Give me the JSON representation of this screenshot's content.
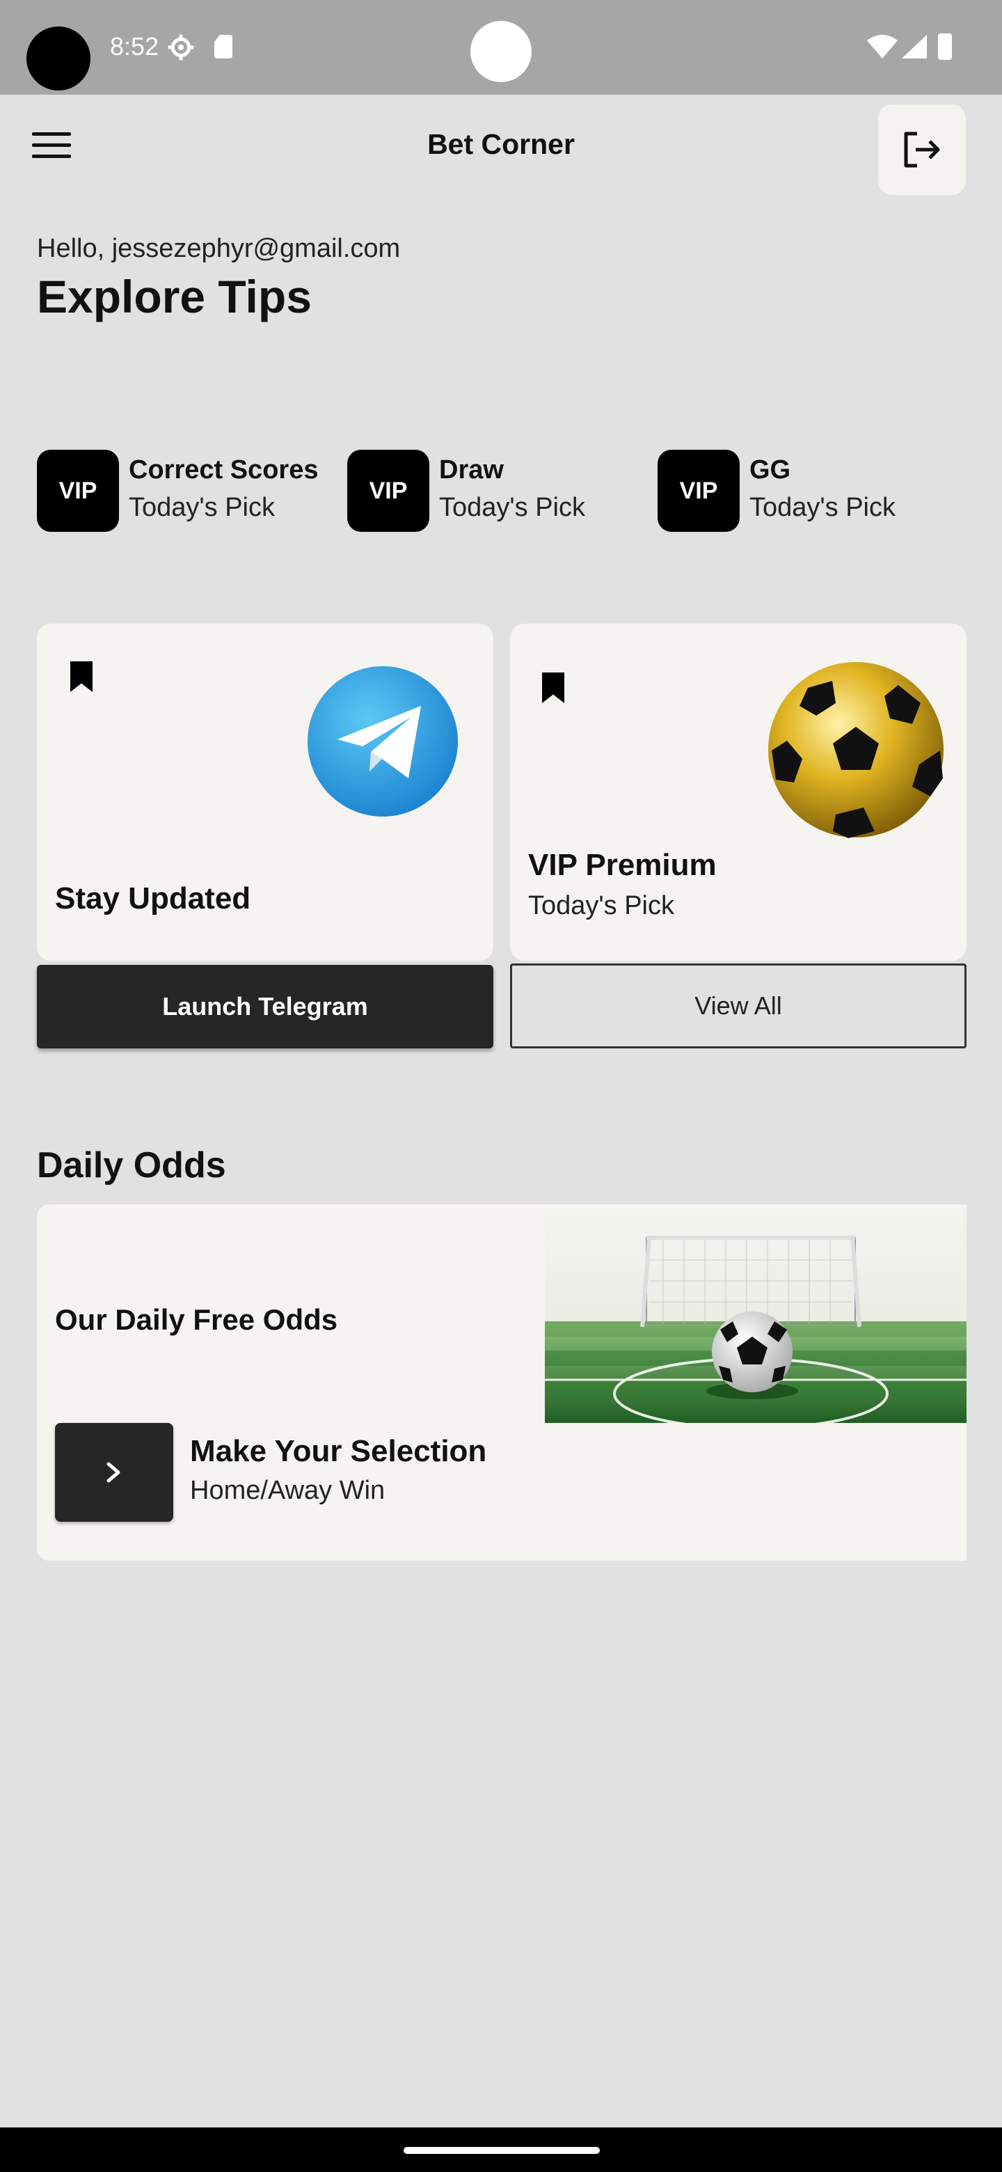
{
  "status_bar": {
    "time": "8:52"
  },
  "app_bar": {
    "title": "Bet Corner"
  },
  "greeting": {
    "hello": "Hello, jessezephyr@gmail.com",
    "headline": "Explore Tips"
  },
  "vip_tips": [
    {
      "badge": "VIP",
      "title": "Correct Scores",
      "subtitle": "Today's Pick"
    },
    {
      "badge": "VIP",
      "title": "Draw",
      "subtitle": "Today's Pick"
    },
    {
      "badge": "VIP",
      "title": "GG",
      "subtitle": "Today's Pick"
    }
  ],
  "cards": {
    "telegram": {
      "title": "Stay Updated",
      "button": "Launch Telegram"
    },
    "premium": {
      "title": "VIP Premium",
      "subtitle": "Today's Pick",
      "button": "View All"
    }
  },
  "daily_odds": {
    "section_title": "Daily Odds",
    "card_title": "Our Daily Free Odds",
    "selection_title": "Make Your Selection",
    "selection_subtitle": "Home/Away Win"
  },
  "colors": {
    "background": "#e1e1e1",
    "card": "#f5f4f0",
    "dark_button": "#262626",
    "badge": "#000000"
  },
  "icons": [
    "menu-icon",
    "logout-icon",
    "settings-icon",
    "sd-card-icon",
    "wifi-icon",
    "signal-icon",
    "battery-icon",
    "bookmark-icon",
    "telegram-icon",
    "chevron-right-icon"
  ]
}
